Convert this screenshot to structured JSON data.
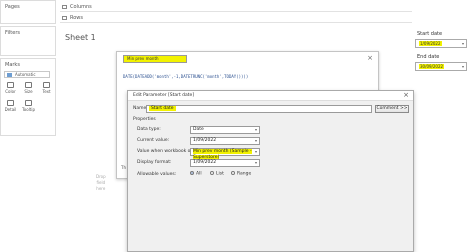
{
  "left": {
    "pages_title": "Pages",
    "filters_title": "Filters",
    "marks_title": "Marks",
    "marks_type": "Automatic",
    "mark_buttons": [
      {
        "label": "Color",
        "icon": "color-icon"
      },
      {
        "label": "Size",
        "icon": "size-icon"
      },
      {
        "label": "Text",
        "icon": "text-icon"
      },
      {
        "label": "Detail",
        "icon": "detail-icon"
      },
      {
        "label": "Tooltip",
        "icon": "tooltip-icon"
      }
    ]
  },
  "shelves": {
    "columns": "Columns",
    "rows": "Rows"
  },
  "sheet": {
    "title": "Sheet 1",
    "drop_hint_1": "Drop",
    "drop_hint_2": "field",
    "drop_hint_3": "here"
  },
  "params": {
    "start_title": "Start date",
    "start_value": "1/09/2022",
    "end_title": "End date",
    "end_value": "30/09/2022"
  },
  "calc": {
    "name": "Min prev month",
    "formula": "DATE(DATEADD('month',-1,DATETRUNC('month',TODAY())))",
    "truncated": "Th"
  },
  "edit": {
    "title": "Edit Parameter [Start date]",
    "name_label": "Name:",
    "name_value": "Start date",
    "comment_button": "Comment >>",
    "properties_label": "Properties",
    "data_type_label": "Data type:",
    "data_type_value": "Date",
    "current_value_label": "Current value:",
    "current_value": "1/09/2022",
    "workbook_opens_label": "Value when workbook opens:",
    "workbook_opens_value": "Min prev month (Sample - Superstore)",
    "display_format_label": "Display format:",
    "display_format_value": "1/09/2022",
    "allowable_label": "Allowable values:",
    "opt_all": "All",
    "opt_list": "List",
    "opt_range": "Range"
  }
}
